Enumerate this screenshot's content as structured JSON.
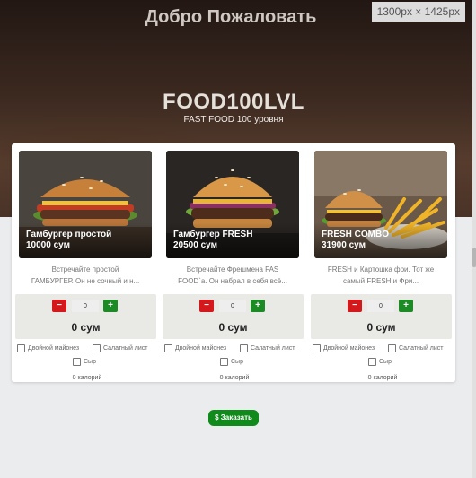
{
  "header": {
    "welcome": "Добро Пожаловать",
    "size_badge": "1300px × 1425px",
    "brand": "FOOD100LVL",
    "tagline": "FAST FOOD 100 уровня"
  },
  "controls": {
    "minus": "−",
    "plus": "+"
  },
  "products": [
    {
      "name_line1": "Гамбургер простой",
      "name_line2": "10000 сум",
      "desc_line1": "Встречайте простой",
      "desc_line2": "ГАМБУРГЕР. Он не сочный и н...",
      "qty": "0",
      "total": "0 сум",
      "options": [
        "Двойной майонез",
        "Салатный лист",
        "Сыр"
      ],
      "calories": "0 калорий"
    },
    {
      "name_line1": "Гамбургер FRESH",
      "name_line2": "20500 сум",
      "desc_line1": "Встречайте Фрешмена FAS",
      "desc_line2": "FOOD`а. Он набрал в себя всё...",
      "qty": "0",
      "total": "0 сум",
      "options": [
        "Двойной майонез",
        "Салатный лист",
        "Сыр"
      ],
      "calories": "0 калорий"
    },
    {
      "name_line1": "FRESH COMBO",
      "name_line2": "31900 сум",
      "desc_line1": "FRESH и Картошка фри. Тот же",
      "desc_line2": "самый FRESH и Фри...",
      "qty": "0",
      "total": "0 сум",
      "options": [
        "Двойной майонез",
        "Салатный лист",
        "Сыр"
      ],
      "calories": "0 калорий"
    }
  ],
  "order_button": "$ Заказать",
  "colors": {
    "minus_button": "#d3191c",
    "plus_button": "#1c8a25",
    "order_button": "#108a1b"
  }
}
